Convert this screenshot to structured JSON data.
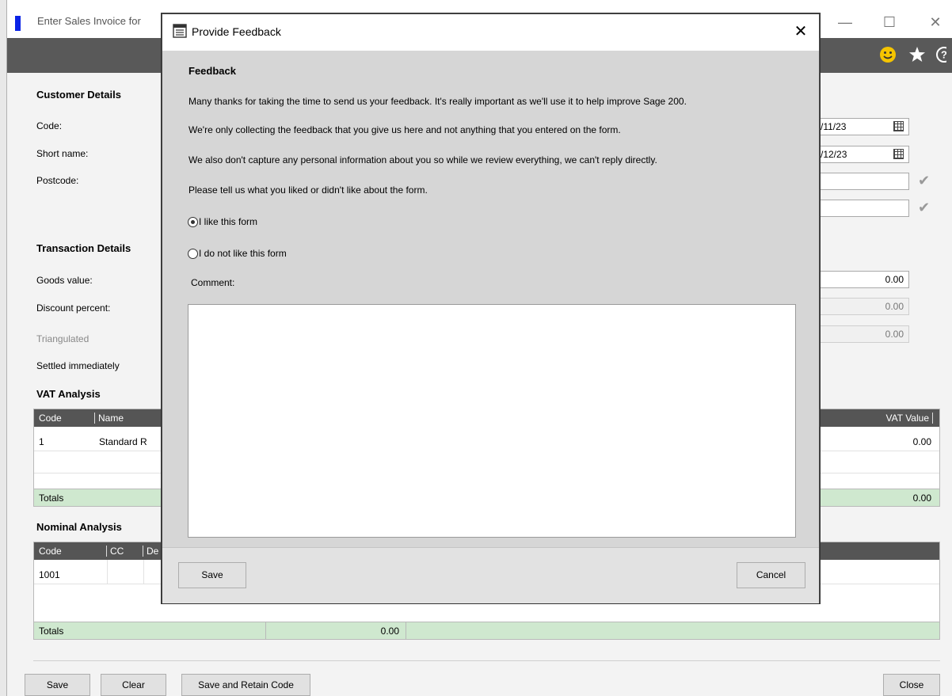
{
  "window": {
    "title": "Enter Sales Invoice for",
    "accent": "#0a23e6",
    "controls": {
      "minimize": "—",
      "maximize": "☐",
      "close": "✕"
    }
  },
  "toolbar": {
    "icons": [
      "smiley-icon",
      "star-icon",
      "help-icon"
    ],
    "help_glyph": "?"
  },
  "customer": {
    "heading": "Customer Details",
    "code_label": "Code:",
    "short_name_label": "Short name:",
    "postcode_label": "Postcode:"
  },
  "right_fields": {
    "date1": "/11/23",
    "date2": "/12/23"
  },
  "transaction": {
    "heading": "Transaction Details",
    "goods_label": "Goods value:",
    "discount_label": "Discount percent:",
    "triangulated_label": "Triangulated",
    "settled_label": "Settled immediately",
    "goods_value": "0.00",
    "discount_value": "0.00",
    "third_value": "0.00"
  },
  "vat": {
    "heading": "VAT Analysis",
    "columns": {
      "code": "Code",
      "name": "Name",
      "vat_value": "VAT Value"
    },
    "rows": [
      {
        "code": "1",
        "name": "Standard R",
        "vat_value": "0.00"
      }
    ],
    "totals_label": "Totals",
    "totals_value": "0.00"
  },
  "nominal": {
    "heading": "Nominal Analysis",
    "columns": {
      "code": "Code",
      "cc": "CC",
      "de": "De"
    },
    "rows": [
      {
        "code": "1001"
      }
    ],
    "totals_label": "Totals",
    "totals_value": "0.00"
  },
  "bottom_buttons": {
    "save": "Save",
    "clear": "Clear",
    "save_retain": "Save and Retain Code",
    "close": "Close"
  },
  "dialog": {
    "title": "Provide Feedback",
    "close_glyph": "✕",
    "heading": "Feedback",
    "para1": "Many thanks for taking the time to send us your feedback. It's really important as we'll use it to help improve Sage 200.",
    "para2": "We're only collecting the feedback that you give us here and not anything that you entered on the form.",
    "para3": "We also don't capture any personal information about you so while we review everything, we can't reply directly.",
    "para4": "Please tell us what you liked or didn't like about the form.",
    "radio_like": "I like this form",
    "radio_dislike": "I do not like this form",
    "comment_label": "Comment:",
    "comment_value": "",
    "save_label": "Save",
    "cancel_label": "Cancel"
  }
}
